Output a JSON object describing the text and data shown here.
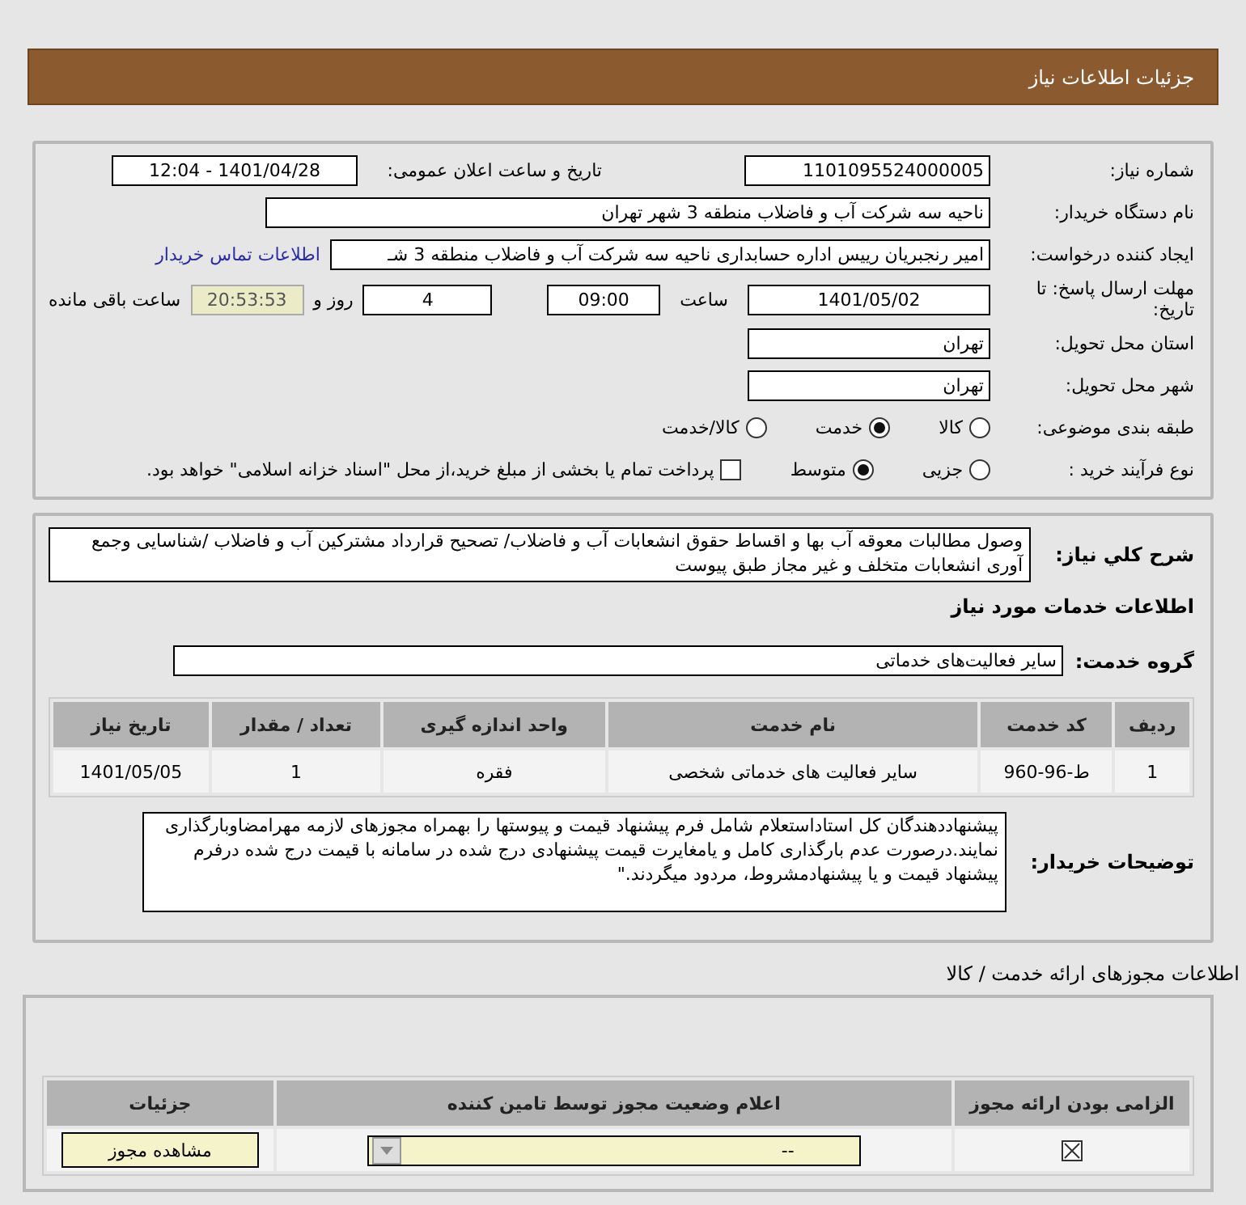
{
  "header": {
    "title": "جزئیات اطلاعات نیاز"
  },
  "details": {
    "need_number": {
      "label": "شماره نیاز:",
      "value": "1101095524000005"
    },
    "announce": {
      "label": "تاریخ و ساعت اعلان عمومی:",
      "value": "1401/04/28 - 12:04"
    },
    "buyer": {
      "label": "نام دستگاه خریدار:",
      "value": "ناحیه سه شرکت آب و فاضلاب منطقه 3 شهر تهران"
    },
    "creator": {
      "label": "ایجاد کننده درخواست:",
      "value": "امیر رنجبریان رییس اداره حسابداری ناحیه سه شرکت آب و فاضلاب منطقه 3 شـ",
      "link": "اطلاعات تماس خریدار"
    },
    "deadline": {
      "label": "مهلت ارسال پاسخ: تا تاریخ:",
      "date": "1401/05/02",
      "time_label": "ساعت",
      "time": "09:00",
      "days": "4",
      "days_label": "روز و",
      "remaining": "20:53:53",
      "remaining_label": "ساعت باقی مانده"
    },
    "province": {
      "label": "استان محل تحویل:",
      "value": "تهران"
    },
    "city": {
      "label": "شهر محل تحویل:",
      "value": "تهران"
    },
    "category": {
      "label": "طبقه بندی موضوعی:",
      "options": [
        {
          "label": "کالا",
          "selected": false
        },
        {
          "label": "خدمت",
          "selected": true
        },
        {
          "label": "کالا/خدمت",
          "selected": false
        }
      ]
    },
    "process": {
      "label": "نوع فرآیند خرید :",
      "options": [
        {
          "label": "جزیی",
          "selected": false
        },
        {
          "label": "متوسط",
          "selected": true
        }
      ],
      "treasury": {
        "label": "پرداخت تمام یا بخشی از مبلغ خرید،از محل \"اسناد خزانه اسلامی\" خواهد بود.",
        "checked": false
      }
    }
  },
  "description": {
    "label": "شرح کلي نیاز:",
    "value": "وصول مطالبات معوقه آب بها و اقساط حقوق انشعابات آب و فاضلاب/ تصحیح قرارداد مشترکین آب و فاضلاب /شناسایی وجمع آوری انشعابات متخلف و غیر مجاز طبق پیوست"
  },
  "services": {
    "heading": "اطلاعات خدمات مورد نیاز",
    "group_label": "گروه خدمت:",
    "group": "سایر فعالیت‌های خدماتی",
    "columns": [
      "ردیف",
      "کد خدمت",
      "نام خدمت",
      "واحد اندازه گیری",
      "تعداد / مقدار",
      "تاریخ نیاز"
    ],
    "rows": [
      [
        "1",
        "ط-96-960",
        "سایر فعالیت های خدماتی شخصی",
        "فقره",
        "1",
        "1401/05/05"
      ]
    ]
  },
  "notes": {
    "label": "توضیحات خریدار:",
    "value": "پیشنهاددهندگان کل استاداستعلام شامل فرم پیشنهاد قیمت و پیوستها را بهمراه مجوزهای لازمه مهرامضاوبارگذاری نمایند.درصورت عدم بارگذاری کامل و یامغایرت قیمت پیشنهادی درج شده در سامانه با قیمت درج شده درفرم پیشنهاد قیمت و یا پیشنهادمشروط، مردود میگردند.\""
  },
  "permits": {
    "title": "اطلاعات مجوزهای ارائه خدمت / کالا",
    "columns": [
      "الزامی بودن ارائه مجوز",
      "اعلام وضعیت مجوز توسط تامین کننده",
      "جزئیات"
    ],
    "rows": [
      {
        "required": true,
        "status": "--",
        "button": "مشاهده مجوز"
      }
    ]
  }
}
